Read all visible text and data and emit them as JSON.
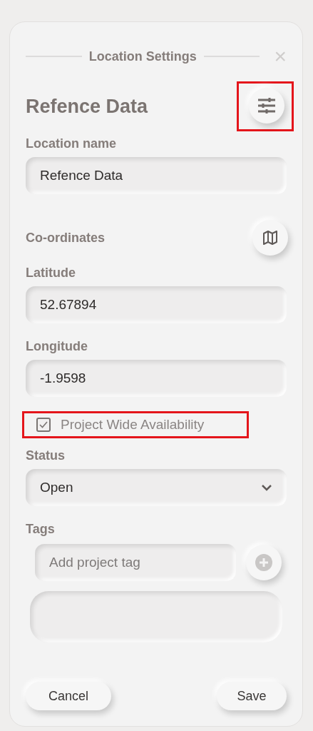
{
  "dialog": {
    "title": "Location Settings",
    "close": "×"
  },
  "heading": {
    "text": "Refence Data",
    "filter_button": {
      "highlighted": true
    }
  },
  "location_name": {
    "label": "Location name",
    "value": "Refence Data"
  },
  "coordinates": {
    "label": "Co-ordinates"
  },
  "latitude": {
    "label": "Latitude",
    "value": "52.67894"
  },
  "longitude": {
    "label": "Longitude",
    "value": "-1.9598"
  },
  "availability": {
    "label": "Project Wide Availability",
    "checked": true,
    "highlighted": true
  },
  "status": {
    "label": "Status",
    "value": "Open"
  },
  "tags": {
    "label": "Tags",
    "placeholder": "Add project tag"
  },
  "buttons": [
    {
      "kind": "cancel",
      "label": "Cancel"
    },
    {
      "kind": "save",
      "label": "Save"
    }
  ]
}
